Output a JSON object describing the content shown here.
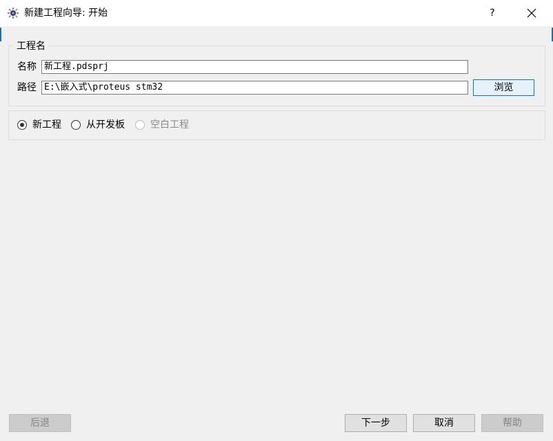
{
  "window": {
    "title": "新建工程向导: 开始",
    "help_label": "?",
    "icon": "proteus-app-icon",
    "close_icon": "close-icon"
  },
  "project_group": {
    "legend": "工程名",
    "name_label": "名称",
    "name_value": "新工程.pdsprj",
    "path_label": "路径",
    "path_value": "E:\\嵌入式\\proteus stm32",
    "browse_label": "浏览"
  },
  "options": [
    {
      "label": "新工程",
      "checked": true,
      "enabled": true
    },
    {
      "label": "从开发板",
      "checked": false,
      "enabled": true
    },
    {
      "label": "空白工程",
      "checked": false,
      "enabled": false
    }
  ],
  "footer": {
    "back_label": "后退",
    "next_label": "下一步",
    "cancel_label": "取消",
    "help_label": "帮助"
  },
  "colors": {
    "selected_button_border": "#0078d7",
    "selected_button_bg": "#e5f1fb"
  }
}
